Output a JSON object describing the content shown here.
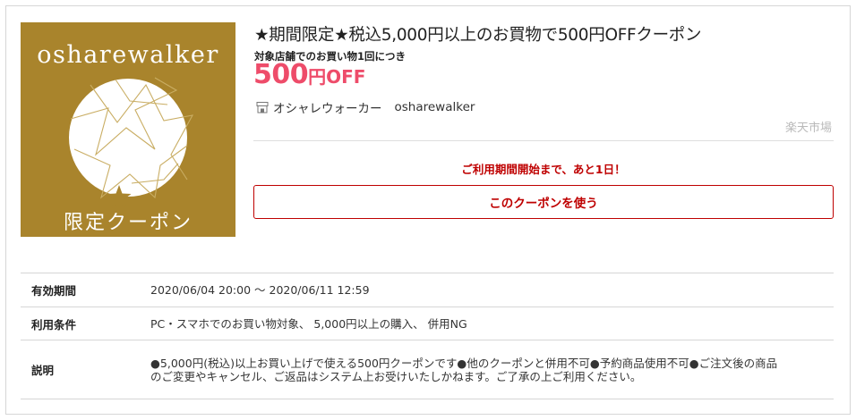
{
  "coupon": {
    "logo_brand": "osharewalker",
    "logo_caption": "限定クーポン",
    "title": "★期間限定★税込5,000円以上のお買物で500円OFFクーポン",
    "target_note": "対象店舗でのお買い物1回につき",
    "discount_number": "500",
    "discount_unit": "円OFF",
    "shop_name": "オシャレウォーカー",
    "shop_id": "osharewalker",
    "market": "楽天市場",
    "notice": "ご利用期間開始まで、あと1日！",
    "use_button": "このクーポンを使う"
  },
  "details": {
    "period_label": "有効期間",
    "period_value": "2020/06/04 20:00 ～ 2020/06/11 12:59",
    "conditions_label": "利用条件",
    "conditions_value": "PC・スマホでのお買い物対象、 5,000円以上の購入、 併用NG",
    "description_label": "説明",
    "description_value": "●5,000円(税込)以上お買い上げで使える500円クーポンです●他のクーポンと併用不可●予約商品使用不可●ご注文後の商品のご変更やキャンセル、ご返品はシステム上お受けいたしかねます。ご了承の上ご利用ください。"
  },
  "colors": {
    "logo_gold": "#a9842c",
    "discount_pink": "#ee4c6a",
    "accent_red": "#bf0000"
  },
  "icons": {
    "shop": "store-icon",
    "logo_star": "star-icon"
  }
}
